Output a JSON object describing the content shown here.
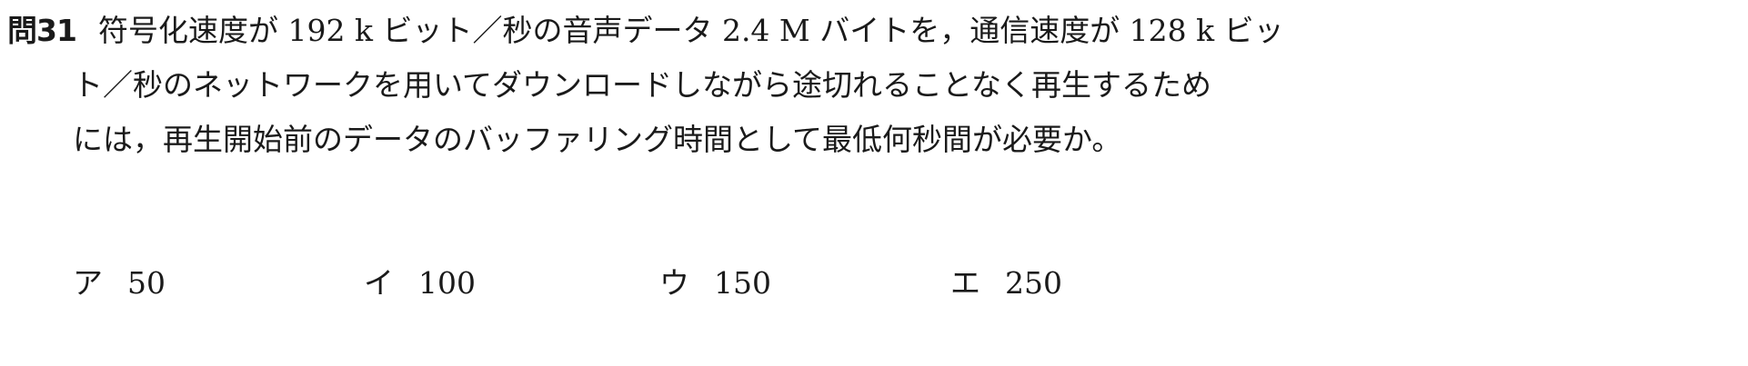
{
  "question": {
    "number": "問31",
    "lines": [
      "符号化速度が 192 k ビット／秒の音声データ 2.4 M バイトを，通信速度が 128 k ビッ",
      "ト／秒のネットワークを用いてダウンロードしながら途切れることなく再生するため",
      "には，再生開始前のデータのバッファリング時間として最低何秒間が必要か。"
    ]
  },
  "choices": [
    {
      "mark": "ア",
      "value": "50"
    },
    {
      "mark": "イ",
      "value": "100"
    },
    {
      "mark": "ウ",
      "value": "150"
    },
    {
      "mark": "エ",
      "value": "250"
    }
  ]
}
